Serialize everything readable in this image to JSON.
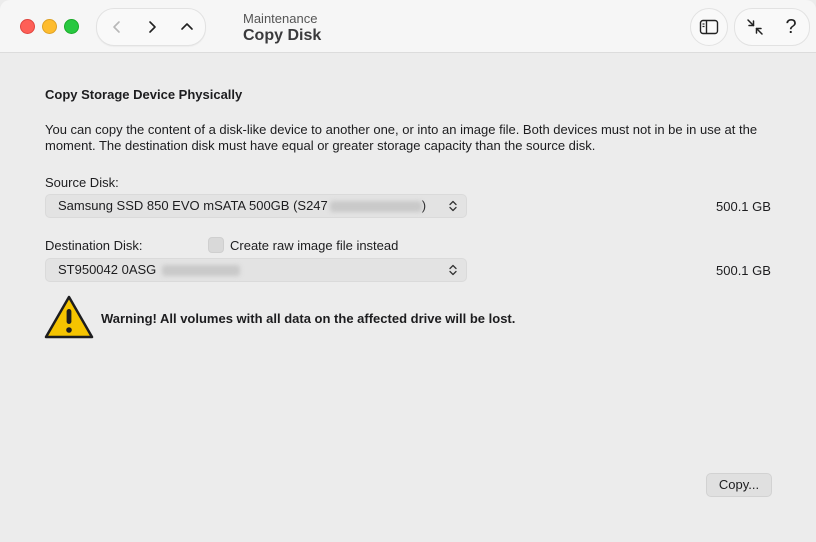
{
  "window": {
    "subtitle": "Maintenance",
    "title": "Copy Disk"
  },
  "toolbar": {
    "help_label": "?",
    "icons": [
      "chevron-left-icon",
      "chevron-right-icon",
      "chevron-up-icon",
      "sidebar-icon",
      "collapse-icon",
      "question-icon"
    ]
  },
  "main": {
    "heading": "Copy Storage Device Physically",
    "description": "You can copy the content of a disk-like device to another one, or into an image file. Both devices must not in be in use at the moment. The destination disk must have equal or greater storage capacity than the source disk.",
    "source": {
      "label": "Source Disk:",
      "value_prefix": "Samsung SSD 850 EVO mSATA 500GB (S247",
      "value_suffix": ")",
      "size": "500.1 GB"
    },
    "destination": {
      "label": "Destination Disk:",
      "checkbox_label": "Create raw image file instead",
      "checkbox_checked": false,
      "value_prefix": "ST950042 0ASG",
      "size": "500.1 GB"
    },
    "warning": "Warning! All volumes with all data on the affected drive will be lost.",
    "copy_button": "Copy..."
  },
  "colors": {
    "close": "#fe5f57",
    "minimize": "#febc2e",
    "zoom": "#28c840",
    "warning_yellow": "#f5c400"
  }
}
